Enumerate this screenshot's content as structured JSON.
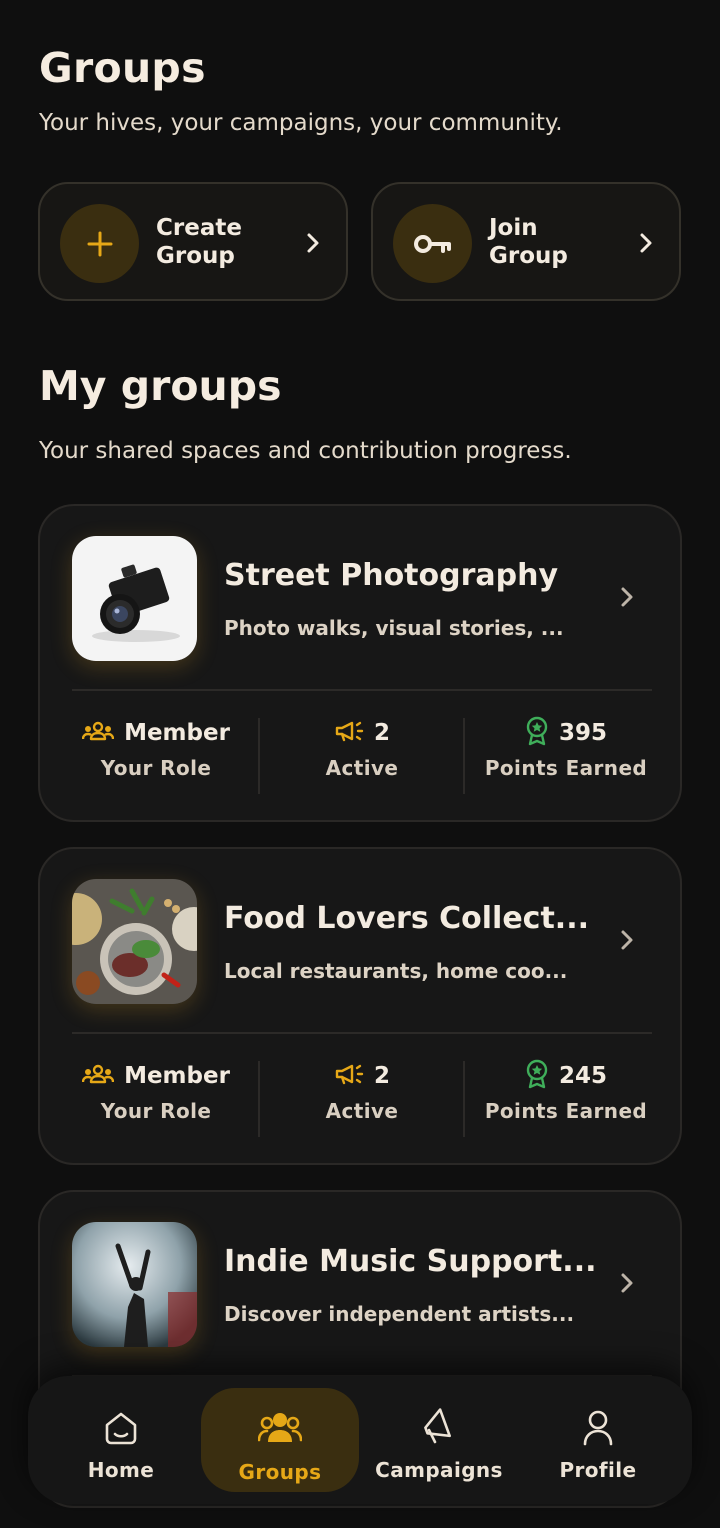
{
  "header": {
    "title": "Groups",
    "subtitle": "Your hives, your campaigns, your community."
  },
  "actions": [
    {
      "label": "Create Group",
      "icon": "plus-icon"
    },
    {
      "label": "Join Group",
      "icon": "key-icon"
    }
  ],
  "my_groups": {
    "title": "My groups",
    "subtitle": "Your shared spaces and contribution progress."
  },
  "groups": [
    {
      "name": "Street Photography",
      "description": "Photo walks, visual stories, ...",
      "role": "Member",
      "role_label": "Your Role",
      "active": "2",
      "active_label": "Active",
      "points": "395",
      "points_label": "Points Earned",
      "image": "camera-photo"
    },
    {
      "name": "Food Lovers Collect...",
      "description": "Local restaurants, home coo...",
      "role": "Member",
      "role_label": "Your Role",
      "active": "2",
      "active_label": "Active",
      "points": "245",
      "points_label": "Points Earned",
      "image": "food-plate-photo"
    },
    {
      "name": "Indie Music Support...",
      "description": "Discover independent artists...",
      "image": "concert-photo"
    }
  ],
  "nav": [
    {
      "label": "Home",
      "icon": "home-icon",
      "active": false
    },
    {
      "label": "Groups",
      "icon": "groups-icon",
      "active": true
    },
    {
      "label": "Campaigns",
      "icon": "megaphone-icon",
      "active": false
    },
    {
      "label": "Profile",
      "icon": "person-icon",
      "active": false
    }
  ],
  "colors": {
    "background": "#0f0f0f",
    "accent": "#e6a817",
    "points_icon": "#3fae5a",
    "card": "#171717"
  }
}
